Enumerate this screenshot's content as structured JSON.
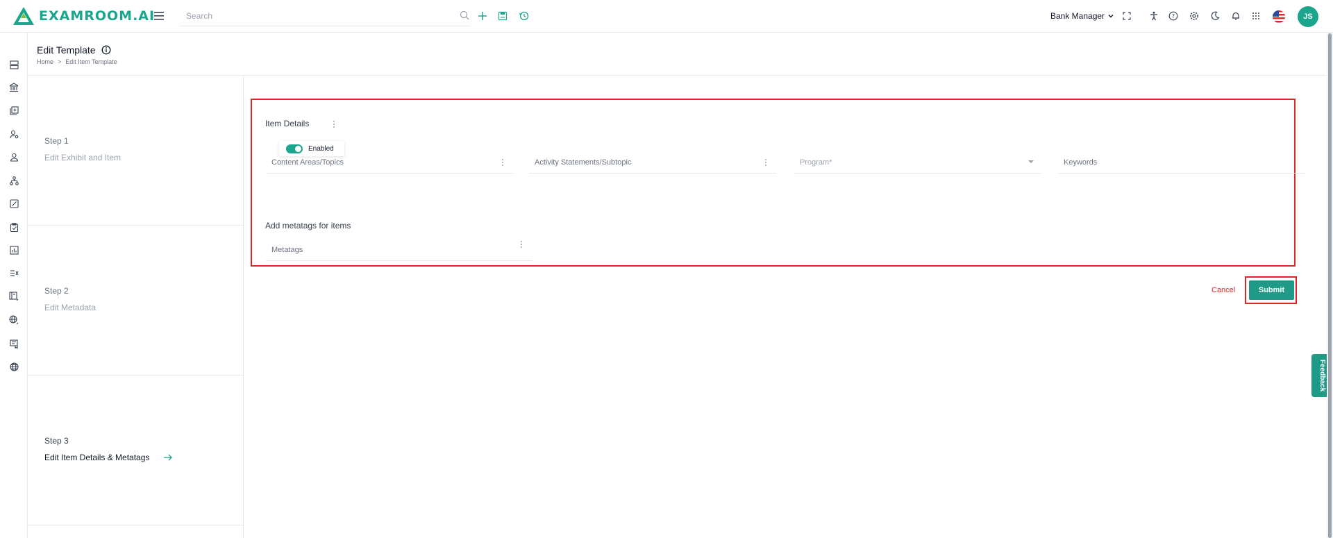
{
  "app": {
    "brand": "EXAMROOM.AI"
  },
  "search": {
    "placeholder": "Search"
  },
  "header": {
    "role": "Bank Manager",
    "avatar_initials": "JS"
  },
  "page": {
    "title": "Edit Template",
    "breadcrumb": {
      "home": "Home",
      "separator": ">",
      "current": "Edit Item Template"
    }
  },
  "stepper": {
    "steps": [
      {
        "num": "Step 1",
        "label": "Edit Exhibit and Item"
      },
      {
        "num": "Step 2",
        "label": "Edit Metadata"
      },
      {
        "num": "Step 3",
        "label": "Edit Item Details & Metatags",
        "active": true
      }
    ]
  },
  "form": {
    "item_details_title": "Item Details",
    "toggle_label": "Enabled",
    "fields": {
      "content_areas": "Content Areas/Topics",
      "activity_statements": "Activity Statements/Subtopic",
      "program": "Program*",
      "keywords": "Keywords"
    },
    "metatags_title": "Add metatags for items",
    "metatags_field": "Metatags",
    "cancel_label": "Cancel",
    "submit_label": "Submit"
  },
  "feedback_label": "Feedback",
  "colors": {
    "accent": "#1aa58c",
    "highlight": "#e02424"
  }
}
